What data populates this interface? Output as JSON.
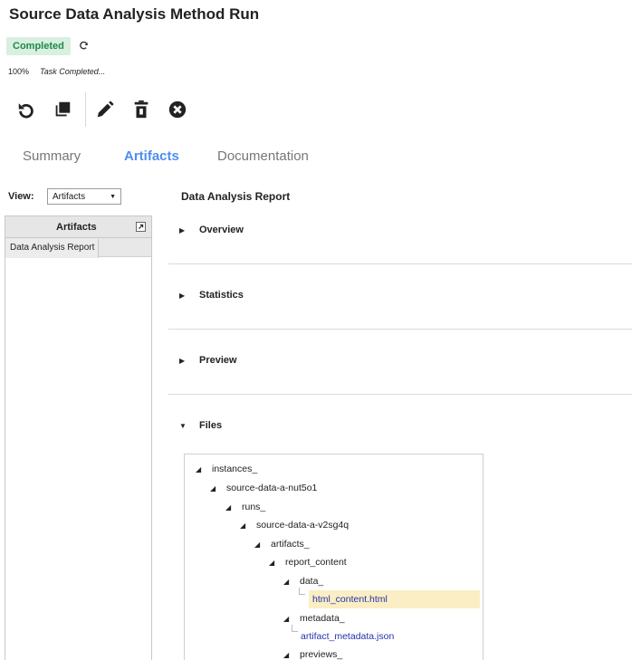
{
  "page": {
    "title": "Source Data Analysis Method Run"
  },
  "status": {
    "badge": "Completed",
    "badge_color": "#1e8a4a",
    "badge_bg": "#d9efe0",
    "refresh_icon": "refresh-icon"
  },
  "progress": {
    "percent_label": "100%",
    "percent": 100,
    "message": "Task Completed..."
  },
  "toolbar": {
    "actions": [
      {
        "name": "rerun",
        "icon": "undo-icon"
      },
      {
        "name": "copy",
        "icon": "copy-icon"
      },
      {
        "name": "edit",
        "icon": "pencil-icon"
      },
      {
        "name": "delete",
        "icon": "trash-icon"
      },
      {
        "name": "cancel",
        "icon": "close-circle-icon"
      }
    ]
  },
  "tabs": [
    {
      "label": "Summary",
      "active": false
    },
    {
      "label": "Artifacts",
      "active": true
    },
    {
      "label": "Documentation",
      "active": false
    }
  ],
  "accent_color": "#4d8ef0",
  "view": {
    "label": "View:",
    "selected": "Artifacts"
  },
  "artifacts_panel": {
    "header": "Artifacts",
    "items": [
      {
        "label": "Data Analysis Report",
        "selected": true
      }
    ]
  },
  "report": {
    "title": "Data Analysis Report",
    "sections": [
      {
        "label": "Overview",
        "expanded": false
      },
      {
        "label": "Statistics",
        "expanded": false
      },
      {
        "label": "Preview",
        "expanded": false
      },
      {
        "label": "Files",
        "expanded": true
      }
    ],
    "files_tree": [
      {
        "label": "instances_",
        "type": "folder",
        "depth": 0
      },
      {
        "label": "source-data-a-nut5o1",
        "type": "folder",
        "depth": 1
      },
      {
        "label": "runs_",
        "type": "folder",
        "depth": 2
      },
      {
        "label": "source-data-a-v2sg4q",
        "type": "folder",
        "depth": 3
      },
      {
        "label": "artifacts_",
        "type": "folder",
        "depth": 4
      },
      {
        "label": "report_content",
        "type": "folder",
        "depth": 5
      },
      {
        "label": "data_",
        "type": "folder",
        "depth": 6
      },
      {
        "label": "html_content.html",
        "type": "file",
        "depth": 7,
        "selected": true
      },
      {
        "label": "metadata_",
        "type": "folder",
        "depth": 6
      },
      {
        "label": "artifact_metadata.json",
        "type": "file",
        "depth": 7,
        "selected": false
      },
      {
        "label": "previews_",
        "type": "folder",
        "depth": 6
      }
    ]
  }
}
